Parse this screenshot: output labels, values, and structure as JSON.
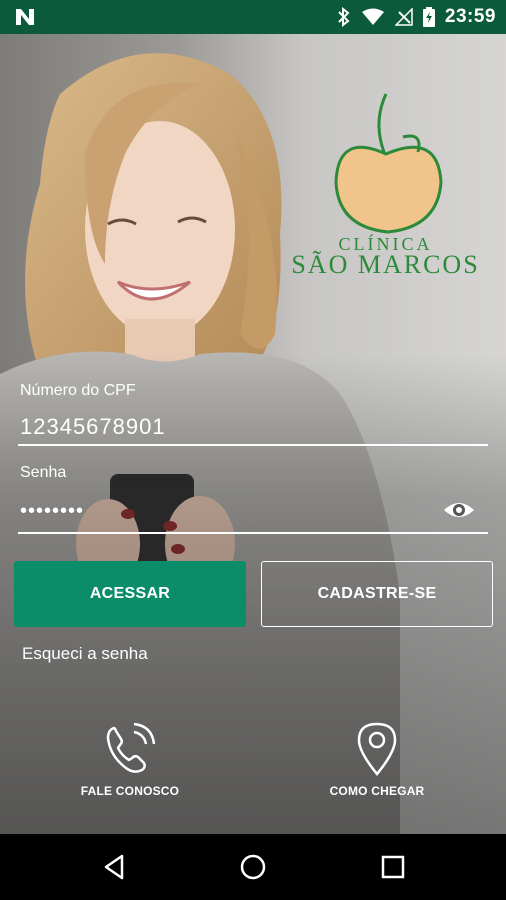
{
  "status_bar": {
    "time": "23:59",
    "icons": [
      "n-icon",
      "bluetooth-icon",
      "wifi-icon",
      "signal-off-icon",
      "battery-charging-icon"
    ]
  },
  "brand": {
    "subtitle": "CLÍNICA",
    "name": "SÃO MARCOS",
    "colors": {
      "green": "#2d8a3a",
      "peach": "#f0c48a"
    }
  },
  "login": {
    "cpf_label": "Número do CPF",
    "cpf_value": "12345678901",
    "password_label": "Senha",
    "password_value": "••••••••"
  },
  "buttons": {
    "primary_label": "ACESSAR",
    "secondary_label": "CADASTRE-SE"
  },
  "forgot_password": "Esqueci a senha",
  "actions": {
    "contact_label": "FALE CONOSCO",
    "directions_label": "COMO CHEGAR"
  },
  "colors": {
    "status_bar": "#0b5a3b",
    "primary_button": "#0b8d6a"
  },
  "nav_bar": {
    "icons": [
      "back-icon",
      "home-icon",
      "recents-icon"
    ]
  }
}
